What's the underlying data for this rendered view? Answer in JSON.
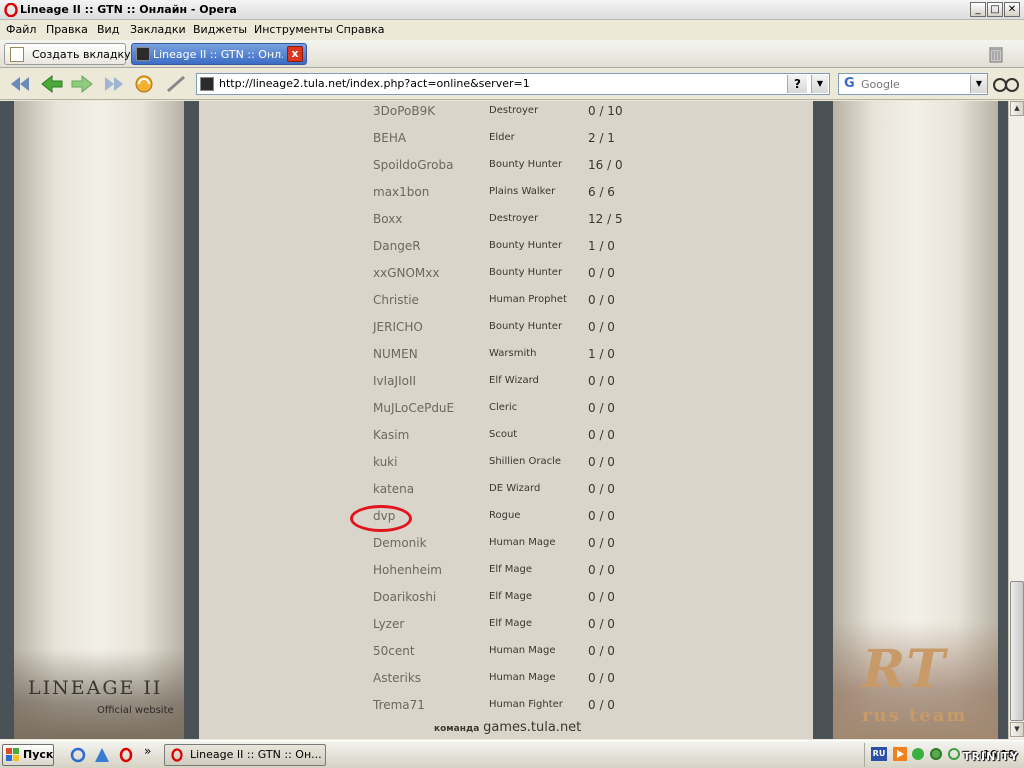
{
  "window": {
    "title": "Lineage II :: GTN :: Онлайн - Opera",
    "minimize": "_",
    "maximize": "□",
    "close": "✕"
  },
  "menu": [
    "Файл",
    "Правка",
    "Вид",
    "Закладки",
    "Виджеты",
    "Инструменты",
    "Справка"
  ],
  "tabs": {
    "new_tab_label": "Создать вкладку",
    "active_tab_label": "Lineage II :: GTN :: Онл...",
    "close_glyph": "x"
  },
  "nav": {
    "url": "http://lineage2.tula.net/index.php?act=online&server=1",
    "help_glyph": "?",
    "dropdown_glyph": "▼",
    "search_engine_glyph": "G",
    "search_placeholder": "Google"
  },
  "content": {
    "players": [
      {
        "name": "3DoPoB9K",
        "class": "Destroyer",
        "score": "0 / 10"
      },
      {
        "name": "BEHA",
        "class": "Elder",
        "score": "2 / 1"
      },
      {
        "name": "SpoildoGroba",
        "class": "Bounty Hunter",
        "score": "16 / 0"
      },
      {
        "name": "max1bon",
        "class": "Plains Walker",
        "score": "6 / 6"
      },
      {
        "name": "Boxx",
        "class": "Destroyer",
        "score": "12 / 5"
      },
      {
        "name": "DangeR",
        "class": "Bounty Hunter",
        "score": "1 / 0"
      },
      {
        "name": "xxGNOMxx",
        "class": "Bounty Hunter",
        "score": "0 / 0"
      },
      {
        "name": "Christie",
        "class": "Human Prophet",
        "score": "0 / 0"
      },
      {
        "name": "JERICHO",
        "class": "Bounty Hunter",
        "score": "0 / 0"
      },
      {
        "name": "NUMEN",
        "class": "Warsmith",
        "score": "1 / 0"
      },
      {
        "name": "IvIaJIoII",
        "class": "Elf Wizard",
        "score": "0 / 0"
      },
      {
        "name": "MuJLoCePduE",
        "class": "Cleric",
        "score": "0 / 0"
      },
      {
        "name": "Kasim",
        "class": "Scout",
        "score": "0 / 0"
      },
      {
        "name": "kuki",
        "class": "Shillien Oracle",
        "score": "0 / 0"
      },
      {
        "name": "katena",
        "class": "DE Wizard",
        "score": "0 / 0"
      },
      {
        "name": "dvp",
        "class": "Rogue",
        "score": "0 / 0"
      },
      {
        "name": "Demonik",
        "class": "Human Mage",
        "score": "0 / 0"
      },
      {
        "name": "Hohenheim",
        "class": "Elf Mage",
        "score": "0 / 0"
      },
      {
        "name": "Doarikoshi",
        "class": "Elf Mage",
        "score": "0 / 0"
      },
      {
        "name": "Lyzer",
        "class": "Elf Mage",
        "score": "0 / 0"
      },
      {
        "name": "50cent",
        "class": "Human Mage",
        "score": "0 / 0"
      },
      {
        "name": "Asteriks",
        "class": "Human Mage",
        "score": "0 / 0"
      },
      {
        "name": "Trema71",
        "class": "Human Fighter",
        "score": "0 / 0"
      }
    ],
    "footer_prefix": "команда",
    "footer_site": "games.tula.net",
    "left_logo": "LINEAGE II",
    "left_logo_sub": "Official website",
    "right_logo": "RT",
    "right_logo_sub": "rus team"
  },
  "taskbar": {
    "start_label": "Пуск",
    "task_label": "Lineage II :: GTN :: Он...",
    "lang": "RU",
    "watermark": "TRINITY",
    "clock": "16:18",
    "more_glyph": "»"
  },
  "colors": {
    "highlight_circle": "#e3141d",
    "active_tab": "#3a6cc4"
  }
}
